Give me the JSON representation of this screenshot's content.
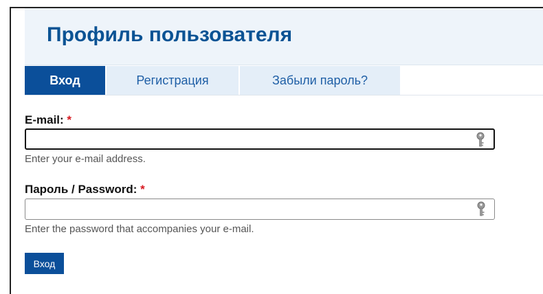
{
  "header": {
    "title": "Профиль пользователя"
  },
  "tabs": [
    {
      "label": "Вход",
      "active": true
    },
    {
      "label": "Регистрация",
      "active": false
    },
    {
      "label": "Забыли пароль?",
      "active": false
    }
  ],
  "form": {
    "email": {
      "label": "E-mail:",
      "required_mark": "*",
      "value": "",
      "hint": "Enter your e-mail address.",
      "icon": "key-icon"
    },
    "password": {
      "label": "Пароль / Password:",
      "required_mark": "*",
      "value": "",
      "hint": "Enter the password that accompanies your e-mail.",
      "icon": "key-icon"
    },
    "submit_label": "Вход"
  },
  "colors": {
    "brand_blue": "#0b4f9a",
    "title_blue": "#0b5394",
    "header_bg": "#eef4fa",
    "tab_inactive_bg": "#e4eef8",
    "required_red": "#d71920"
  }
}
